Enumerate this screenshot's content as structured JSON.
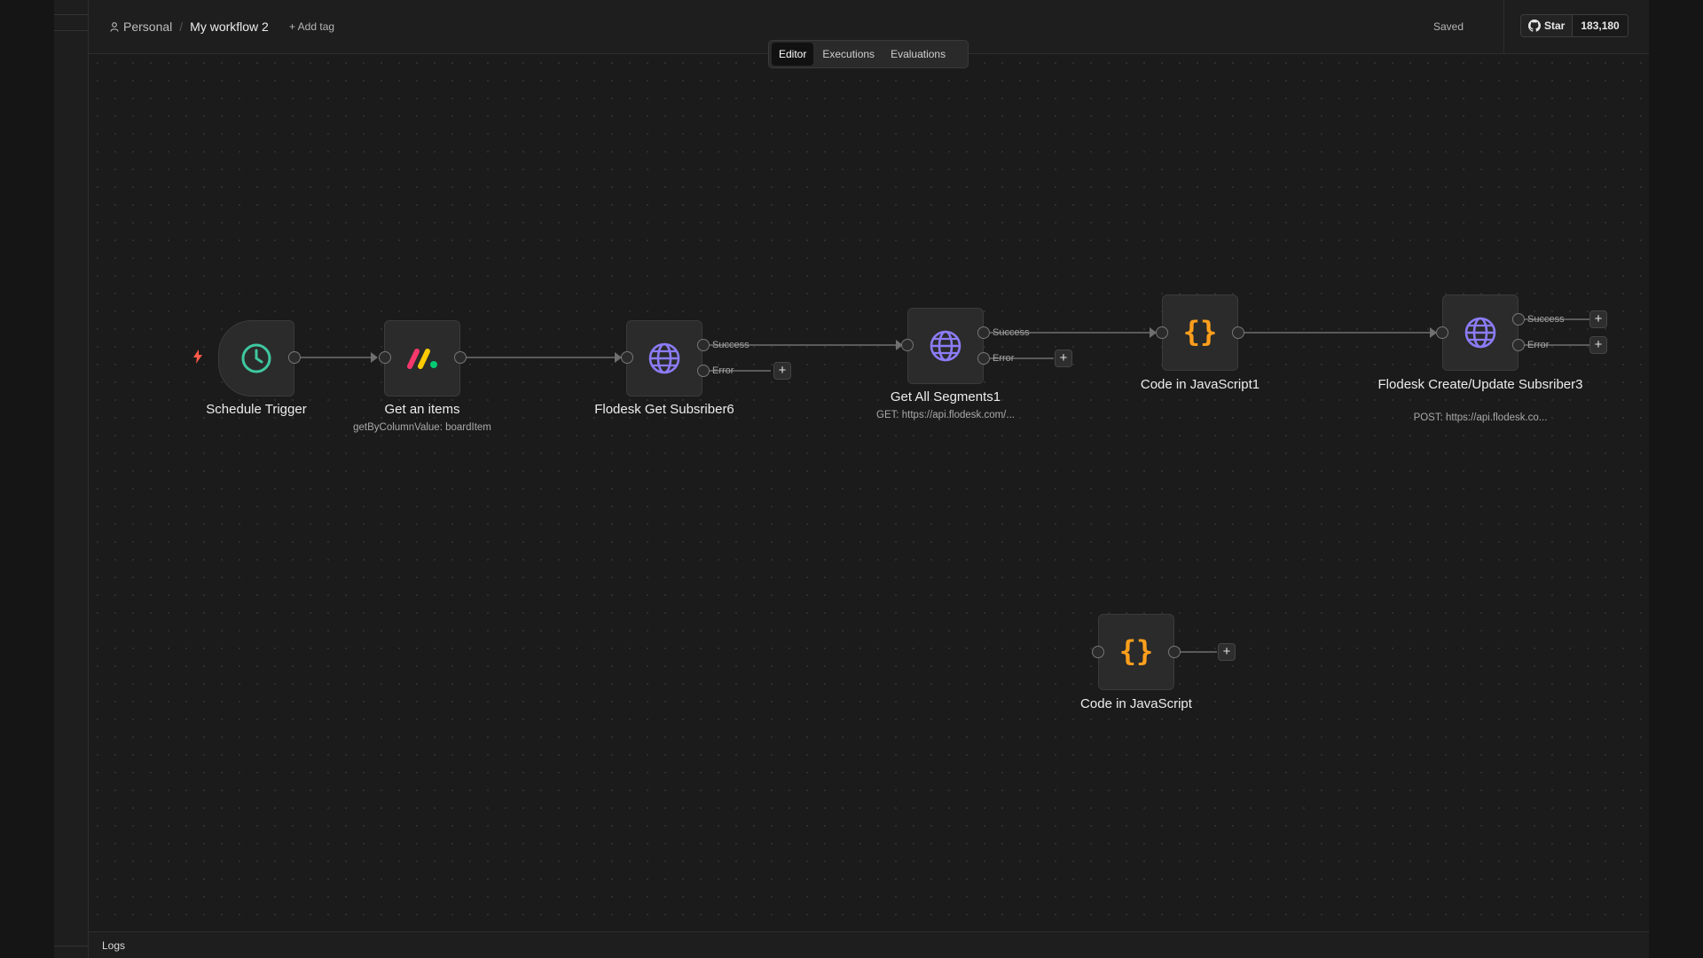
{
  "header": {
    "breadcrumb_project": "Personal",
    "workflow_name": "My workflow 2",
    "add_tag": "+ Add tag",
    "save_status": "Saved",
    "github_star": "Star",
    "github_count": "183,180"
  },
  "tabs": [
    {
      "label": "Editor",
      "active": true
    },
    {
      "label": "Executions",
      "active": false
    },
    {
      "label": "Evaluations",
      "active": false
    }
  ],
  "nodes": {
    "schedule": {
      "label": "Schedule Trigger",
      "icon": "clock-icon"
    },
    "monday": {
      "label": "Get an items",
      "sub": "getByColumnValue: boardItem",
      "icon": "monday-logo-icon"
    },
    "flodesk_get": {
      "label": "Flodesk Get Subsriber6",
      "icon": "globe-icon"
    },
    "segments": {
      "label": "Get All Segments1",
      "sub": "GET: https://api.flodesk.com/...",
      "icon": "globe-icon"
    },
    "code1": {
      "label": "Code in JavaScript1",
      "icon": "code-braces-icon"
    },
    "flodesk_upd": {
      "label": "Flodesk Create/Update Subsriber3",
      "sub": "POST: https://api.flodesk.co...",
      "icon": "globe-icon"
    },
    "code": {
      "label": "Code in JavaScript",
      "icon": "code-braces-icon"
    }
  },
  "outputs": {
    "success": "Success",
    "error": "Error",
    "plus": "+"
  },
  "logs": {
    "label": "Logs"
  },
  "colors": {
    "trigger_accent": "#3fc8a0",
    "http_accent": "#8b7cf6",
    "code_accent": "#ff9f1c",
    "bolt": "#ff5a4a"
  }
}
